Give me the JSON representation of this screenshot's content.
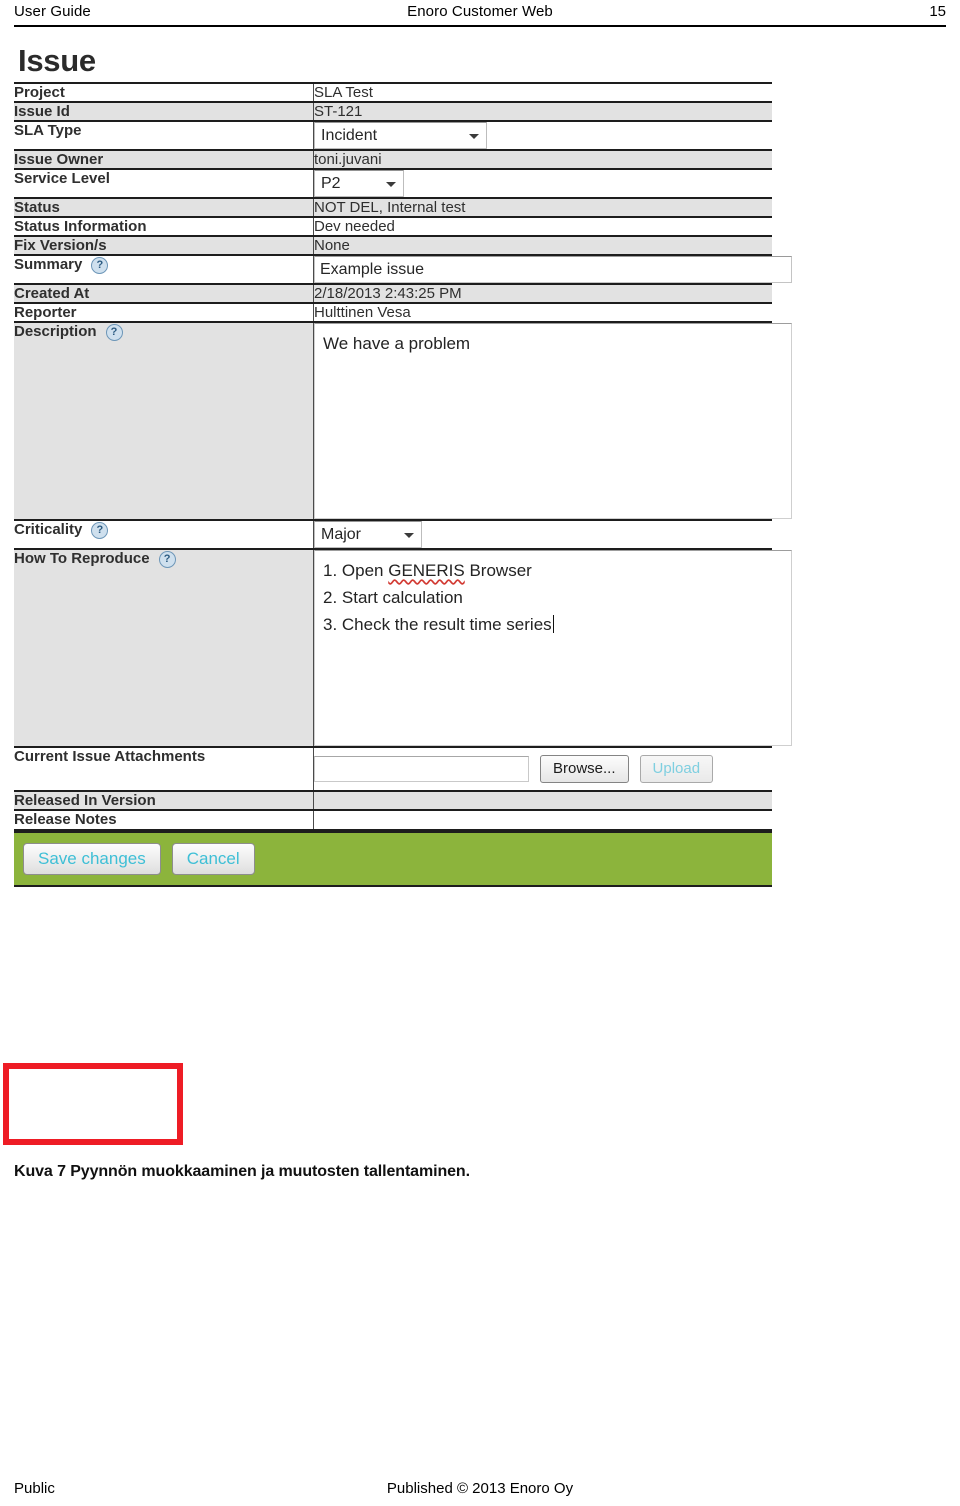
{
  "header": {
    "left": "User Guide",
    "center": "Enoro Customer Web",
    "page_number": "15"
  },
  "figure": {
    "title": "Issue",
    "help_icon_glyph": "?",
    "rows": [
      {
        "label": "Project",
        "value": "SLA Test"
      },
      {
        "label": "Issue Id",
        "value": "ST-121"
      },
      {
        "label": "SLA Type",
        "value": "Incident"
      },
      {
        "label": "Issue Owner",
        "value": "toni.juvani"
      },
      {
        "label": "Service Level",
        "value": "P2"
      },
      {
        "label": "Status",
        "value": "NOT DEL, Internal test"
      },
      {
        "label": "Status Information",
        "value": "Dev needed"
      },
      {
        "label": "Fix Version/s",
        "value": "None"
      },
      {
        "label": "Summary",
        "value": "Example issue"
      },
      {
        "label": "Created At",
        "value": "2/18/2013 2:43:25 PM"
      },
      {
        "label": "Reporter",
        "value": "Hulttinen Vesa"
      },
      {
        "label": "Description",
        "value": "We have a problem"
      },
      {
        "label": "Criticality",
        "value": "Major"
      },
      {
        "label": "How To Reproduce",
        "value": ""
      },
      {
        "label": "Current Issue Attachments",
        "value": ""
      },
      {
        "label": "Released In Version",
        "value": ""
      },
      {
        "label": "Release Notes",
        "value": ""
      }
    ],
    "reproduce_steps": {
      "line1_prefix": "1. Open ",
      "line1_misspelled": "GENERIS",
      "line1_suffix": " Browser",
      "line2": "2. Start calculation",
      "line3": "3. Check the result time series"
    },
    "attachments": {
      "file_field_value": "",
      "file_field_placeholder": "",
      "browse_label": "Browse...",
      "upload_label": "Upload"
    },
    "action_bar": {
      "save_label": "Save changes",
      "cancel_label": "Cancel",
      "bar_color": "#8cb43c",
      "button_text_color": "#3ebfd6"
    },
    "annotation": {
      "color": "#ee1c25"
    }
  },
  "caption": "Kuva 7 Pyynnön muokkaaminen ja muutosten tallentaminen.",
  "footer": {
    "left": "Public",
    "center": "Published © 2013 Enoro Oy"
  }
}
